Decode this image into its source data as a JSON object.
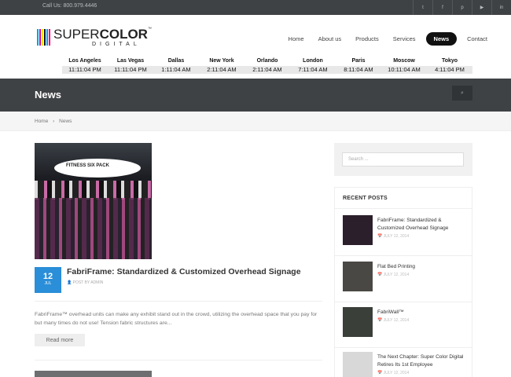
{
  "topbar": {
    "phone": "Call Us: 800.979.4446",
    "social": [
      {
        "icon": "twitter-icon",
        "glyph": "t"
      },
      {
        "icon": "facebook-icon",
        "glyph": "f"
      },
      {
        "icon": "pinterest-icon",
        "glyph": "p"
      },
      {
        "icon": "youtube-icon",
        "glyph": "▶"
      },
      {
        "icon": "linkedin-icon",
        "glyph": "in"
      }
    ]
  },
  "logo": {
    "word_light": "SUPER",
    "word_bold": "COLOR",
    "tm": "™",
    "sub": "DIGITAL",
    "bar_colors": [
      "#00a0e0",
      "#e6007e",
      "#ffe600",
      "#111111",
      "#00a0e0",
      "#e6007e"
    ]
  },
  "nav": {
    "items": [
      {
        "label": "Home",
        "active": false
      },
      {
        "label": "About us",
        "active": false
      },
      {
        "label": "Products",
        "active": false
      },
      {
        "label": "Services",
        "active": false
      },
      {
        "label": "News",
        "active": true
      },
      {
        "label": "Contact",
        "active": false
      }
    ]
  },
  "clocks": [
    {
      "city": "Los Angeles",
      "time": "11:11:04 PM"
    },
    {
      "city": "Las Vegas",
      "time": "11:11:04 PM"
    },
    {
      "city": "Dallas",
      "time": "1:11:04 AM"
    },
    {
      "city": "New York",
      "time": "2:11:04 AM"
    },
    {
      "city": "Orlando",
      "time": "2:11:04 AM"
    },
    {
      "city": "London",
      "time": "7:11:04 AM"
    },
    {
      "city": "Paris",
      "time": "8:11:04 AM"
    },
    {
      "city": "Moscow",
      "time": "10:11:04 AM"
    },
    {
      "city": "Tokyo",
      "time": "4:11:04 PM"
    }
  ],
  "page": {
    "title": "News",
    "search_icon": "⌕",
    "breadcrumb": {
      "home": "Home",
      "sep": "›",
      "current": "News"
    }
  },
  "post": {
    "day": "12",
    "month": "JUL",
    "title": "FabriFrame: Standardized & Customized Overhead Signage",
    "meta": "👤 POST BY ADMIN",
    "image_text": "FITNESS   SIX PACK",
    "excerpt": "FabriFrame™ overhead units can make any exhibit stand out in the crowd, utilizing the overhead space that you pay for but many times do not use! Tension fabric structures are...",
    "read_more": "Read more"
  },
  "sidebar": {
    "search_placeholder": "Search ...",
    "recent_title": "RECENT POSTS",
    "recent": [
      {
        "title": "FabriFrame: Standardized & Customized Overhead Signage",
        "date": "📅 JULY 12, 2014",
        "thumb": "#2b1f2b"
      },
      {
        "title": "Flat Bed Printing",
        "date": "📅 JULY 12, 2014",
        "thumb": "#4a4844"
      },
      {
        "title": "FabriWall™",
        "date": "📅 JULY 12, 2014",
        "thumb": "#3a3f3a"
      },
      {
        "title": "The Next Chapter: Super Color Digital Retires Its 1st Employee",
        "date": "📅 JULY 12, 2014",
        "thumb": "#d8d8d8"
      }
    ]
  }
}
